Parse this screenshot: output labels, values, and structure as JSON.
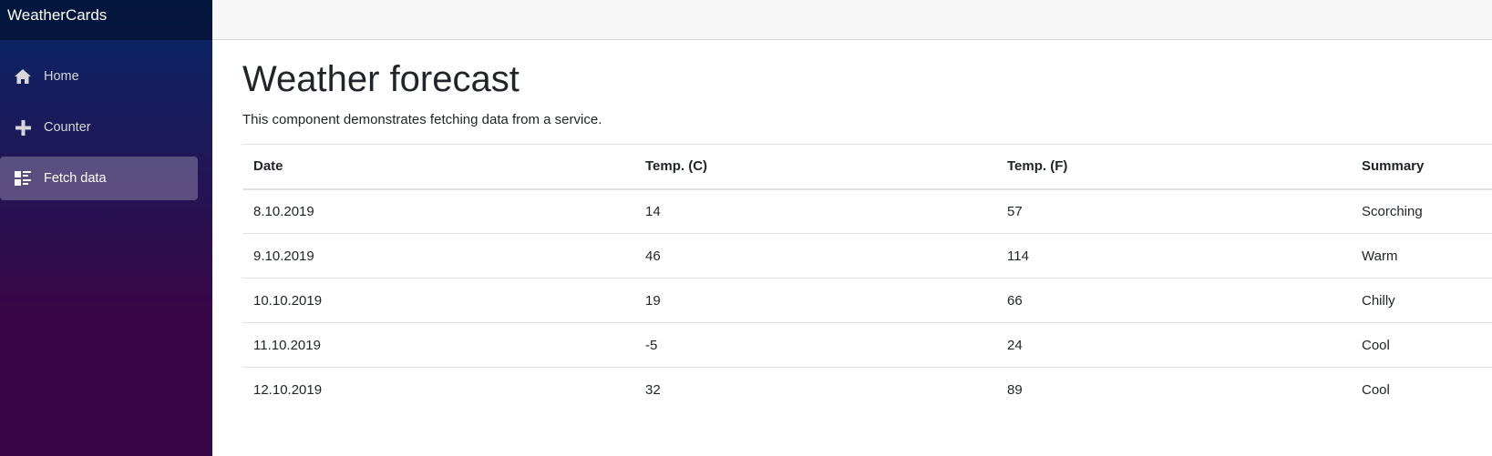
{
  "app": {
    "brand": "WeatherCards"
  },
  "sidebar": {
    "items": [
      {
        "label": "Home",
        "icon": "home-icon",
        "active": false
      },
      {
        "label": "Counter",
        "icon": "plus-icon",
        "active": false
      },
      {
        "label": "Fetch data",
        "icon": "list-rich-icon",
        "active": true
      }
    ]
  },
  "main": {
    "title": "Weather forecast",
    "description": "This component demonstrates fetching data from a service.",
    "table": {
      "headers": [
        "Date",
        "Temp. (C)",
        "Temp. (F)",
        "Summary"
      ],
      "rows": [
        [
          "8.10.2019",
          "14",
          "57",
          "Scorching"
        ],
        [
          "9.10.2019",
          "46",
          "114",
          "Warm"
        ],
        [
          "10.10.2019",
          "19",
          "66",
          "Chilly"
        ],
        [
          "11.10.2019",
          "-5",
          "24",
          "Cool"
        ],
        [
          "12.10.2019",
          "32",
          "89",
          "Cool"
        ]
      ]
    }
  },
  "colors": {
    "sidebar_top": "#052767",
    "sidebar_bottom": "#3a0647",
    "topbar": "#f7f7f7"
  }
}
